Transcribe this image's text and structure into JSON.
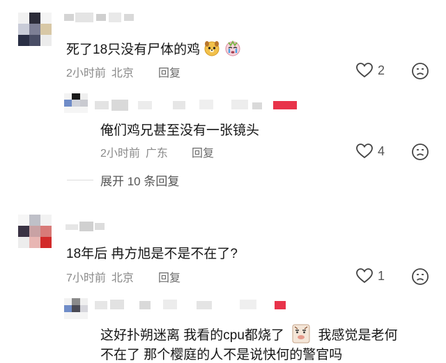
{
  "comments": [
    {
      "text": "死了18只没有尸体的鸡",
      "time": "2小时前",
      "location": "北京",
      "reply_label": "回复",
      "likes": "2",
      "emoji_icons": [
        "dog-face-emoji-icon",
        "crying-face-emoji-icon"
      ],
      "replies": [
        {
          "text": "俺们鸡兄甚至没有一张镜头",
          "time": "2小时前",
          "location": "广东",
          "reply_label": "回复",
          "likes": "4"
        }
      ],
      "expand_label": "展开 10 条回复"
    },
    {
      "text": "18年后 冉方旭是不是不在了?",
      "time": "7小时前",
      "location": "北京",
      "reply_label": "回复",
      "likes": "1",
      "replies": [
        {
          "text_before_sticker": "这好扑朔迷离 我看的cpu都烧了",
          "text_after_sticker": "我感觉是老何",
          "text_line2": "不在了 那个樱庭的人不是说快何的警官吗",
          "sticker_icon": "cartoon-face-sticker-icon"
        }
      ]
    }
  ],
  "colors": {
    "text": "#161616",
    "meta": "#8a8a8a",
    "accent_red": "#e8334a"
  }
}
